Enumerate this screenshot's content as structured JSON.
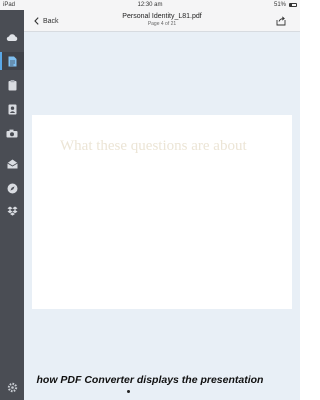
{
  "status_bar": {
    "device": "iPad",
    "time": "12:30 am",
    "battery": "51%"
  },
  "top_bar": {
    "back_label": "Back",
    "title": "Personal Identity_L81.pdf",
    "subtitle": "Page 4 of 21"
  },
  "document": {
    "page_heading": "What these questions are about"
  },
  "caption": "how PDF Converter displays the presentation",
  "sidebar": {
    "icons": [
      "cloud-icon",
      "documents-icon",
      "clipboard-icon",
      "contacts-icon",
      "camera-icon",
      "mail-icon",
      "compass-icon",
      "dropbox-icon",
      "settings-icon"
    ],
    "active": "documents-icon"
  },
  "colors": {
    "sidebar": "#4a4d54",
    "accent": "#5aa7e6",
    "viewer_background": "#e8eff6",
    "heading_text": "#ece5d6"
  }
}
